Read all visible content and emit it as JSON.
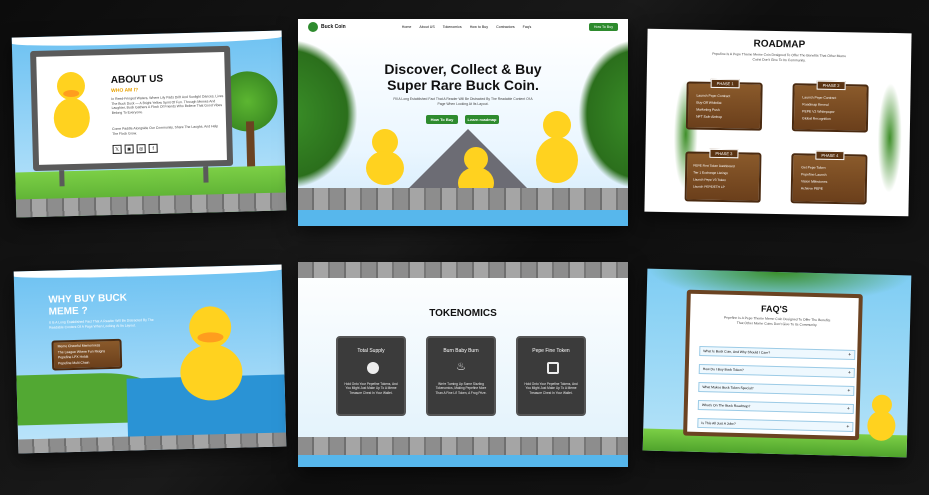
{
  "about": {
    "title": "ABOUT US",
    "subtitle": "WHO AM I?",
    "para1": "In Reed-Fringed Waters, Where Lily Pads Drift And Sunlight Dances, Lives The Buck Duck — A Bright Yellow Spirit Of Fun. Through Memes And Laughter, Buck Gathers A Flock Of Friends Who Believe That Good Vibes Belong To Everyone.",
    "para2": "Come Paddle Alongside Our Community, Share The Laughs, And Help The Flock Grow.",
    "social_icons": [
      "twitter-icon",
      "discord-icon",
      "instagram-icon",
      "facebook-icon"
    ]
  },
  "hero": {
    "brand": "Buck Coin",
    "nav": [
      "Home",
      "About US",
      "Tokenomics",
      "How to Buy",
      "Contractors",
      "Faq's"
    ],
    "cta": "How To Buy",
    "title_line1": "Discover, Collect & Buy",
    "title_line2": "Super Rare Buck Coin.",
    "subtitle": "Fill A Long Established Fact That A Reader Will Be Distracted By The Readable Content Of A Page When Looking At Its Layout.",
    "btn_primary": "How To Buy",
    "btn_secondary": "Learn roadmap"
  },
  "roadmap": {
    "title": "ROADMAP",
    "subtitle": "Pepefine Is A Pepe Theme Meme Coin Designed To Offer The Benefits That Other Meme Coins Don't Give To Its Community.",
    "phases": [
      {
        "label": "PHASE 1",
        "items": [
          "Launch Pepe Contract",
          "Buy-Off Whitelist",
          "Marketing Push",
          "NFT Sale Airdrop"
        ]
      },
      {
        "label": "PHASE 2",
        "items": [
          "Launch Pepe Contract",
          "Roadmap Reveal",
          "PEPE V2 Whitepaper",
          "Global Recognition"
        ]
      },
      {
        "label": "PHASE 3",
        "items": [
          "PEPE First Token Dashboard",
          "Tier 1 Exchange Listings",
          "Launch Pepe V3 Token",
          "Launch PEPE/ETH LP"
        ]
      },
      {
        "label": "PHASE 4",
        "items": [
          "Get Pepe Token",
          "Pepefine Launch",
          "Vision Milestones",
          "Achieve PEPE"
        ]
      }
    ]
  },
  "why": {
    "title_line1": "WHY BUY BUCK",
    "title_line2": "MEME ?",
    "subtitle": "It Is A Long Established Fact That A Reader Will Be Distracted By The Readable Content Of A Page When Looking At Its Layout.",
    "items": [
      "Meme Cheerful Memoriness",
      "The League Where Fun Reigns",
      "Pepefine LPX Holds",
      "Pepefine Multi Chain"
    ]
  },
  "tokenomics": {
    "title": "TOKENOMICS",
    "cards": [
      {
        "title": "Total Supply",
        "text": "Hold Onto Your Pepefine Tokens, And You Might Just Make Up To A Meme Treasure Chest In Your Wallet."
      },
      {
        "title": "Burn Baby Burn",
        "text": "We're Turning Up Some Sizzling Tokenomics, Making Pepefine More Than A Fine Lil' Token, A Frog Prize."
      },
      {
        "title": "Pepe Fine Token",
        "text": "Hold Onto Your Pepefine Tokens, And You Might Just Make Up To A Meme Treasure Chest In Your Wallet."
      }
    ]
  },
  "faq": {
    "title": "FAQ'S",
    "subtitle": "Pepefine Is A Pepe Theme Meme Coin Designed To Offer The Benefits That Other Meme Coins Don't Give To Its Community.",
    "questions": [
      "What Is Buck Coin, And Why Should I Care?",
      "How Do I Buy Buck Token?",
      "What Makes Buck Token Special?",
      "What's On The Buck Roadmap?",
      "Is This All Just A Joke?"
    ]
  }
}
